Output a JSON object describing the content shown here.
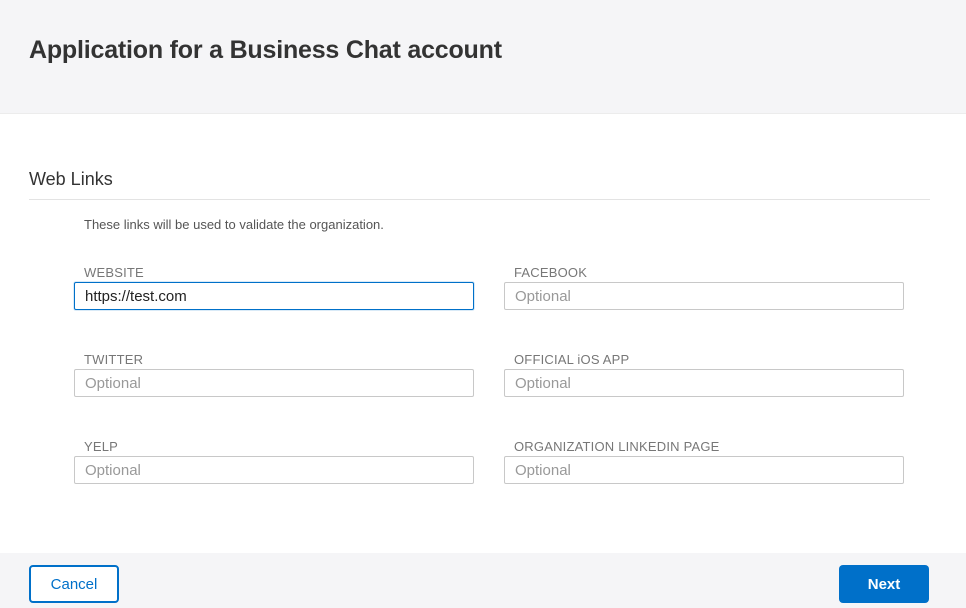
{
  "header": {
    "title": "Application for a Business Chat account"
  },
  "section": {
    "title": "Web Links",
    "description": "These links will be used to validate the organization."
  },
  "fields": {
    "website": {
      "label": "WEBSITE",
      "value": "https://test.com",
      "placeholder": ""
    },
    "facebook": {
      "label": "FACEBOOK",
      "value": "",
      "placeholder": "Optional"
    },
    "twitter": {
      "label": "TWITTER",
      "value": "",
      "placeholder": "Optional"
    },
    "ios_app": {
      "label": "OFFICIAL iOS APP",
      "value": "",
      "placeholder": "Optional"
    },
    "yelp": {
      "label": "YELP",
      "value": "",
      "placeholder": "Optional"
    },
    "linkedin": {
      "label": "ORGANIZATION LINKEDIN PAGE",
      "value": "",
      "placeholder": "Optional"
    }
  },
  "footer": {
    "cancel_label": "Cancel",
    "next_label": "Next"
  },
  "colors": {
    "accent": "#0070c9",
    "header_bg": "#f5f5f7"
  }
}
